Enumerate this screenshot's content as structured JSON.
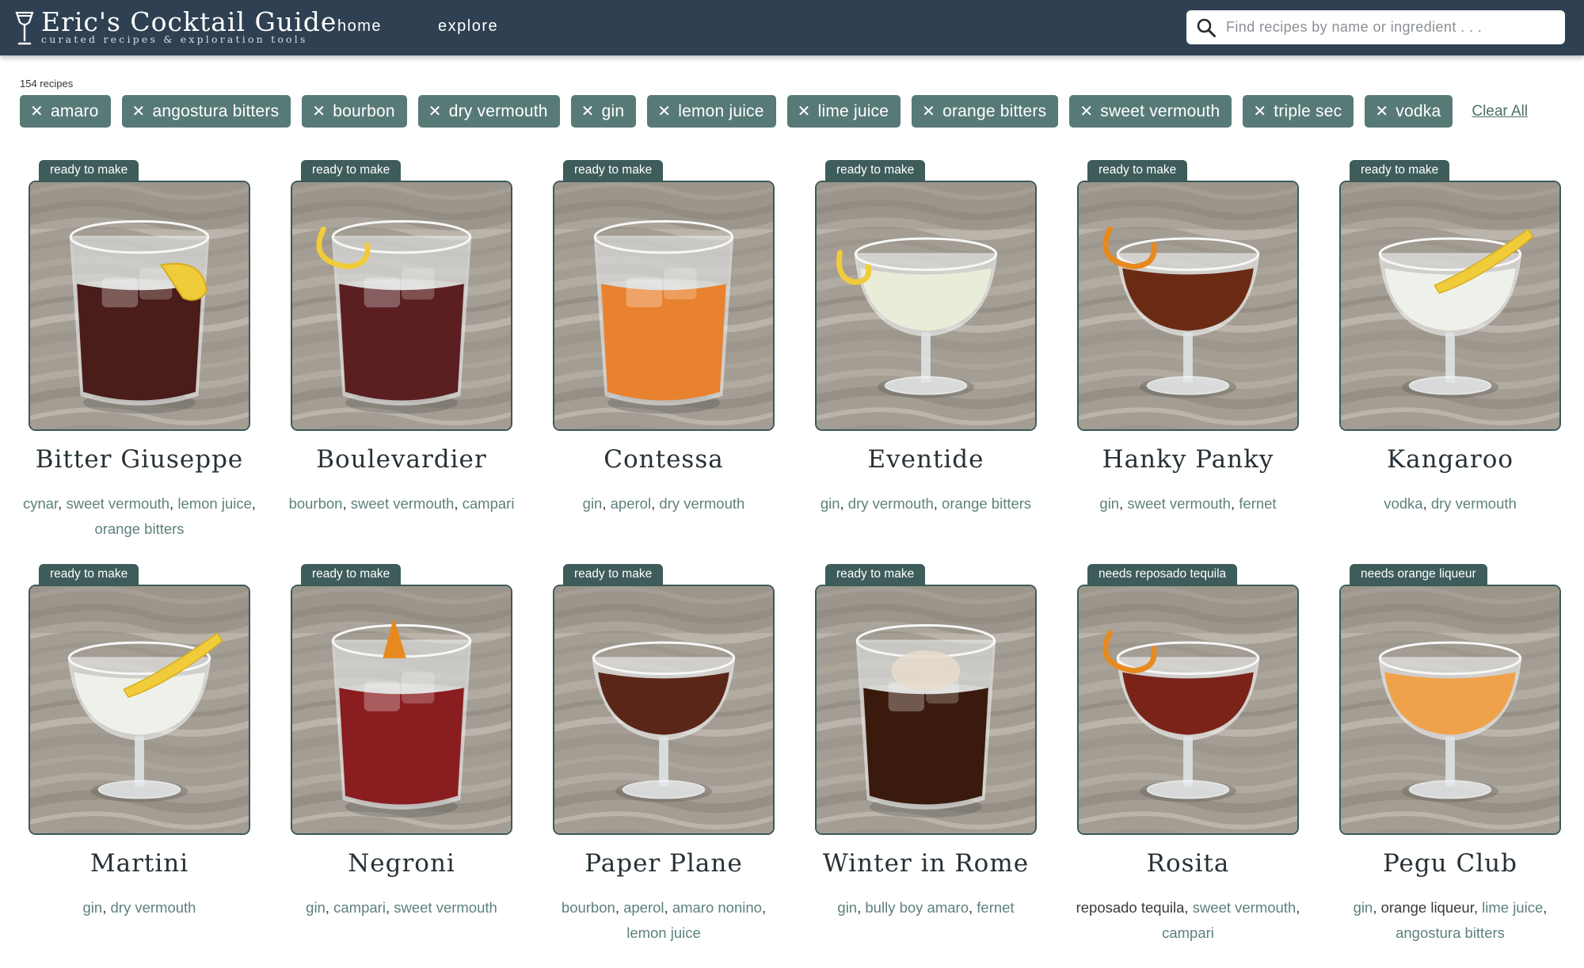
{
  "header": {
    "brand_title": "Eric's Cocktail Guide",
    "brand_subtitle": "curated recipes & exploration tools",
    "nav": [
      "home",
      "explore"
    ],
    "search_placeholder": "Find recipes by name or ingredient . . ."
  },
  "filters": {
    "recipe_count": "154 recipes",
    "chips": [
      "amaro",
      "angostura bitters",
      "bourbon",
      "dry vermouth",
      "gin",
      "lemon juice",
      "lime juice",
      "orange bitters",
      "sweet vermouth",
      "triple sec",
      "vodka"
    ],
    "clear_all": "Clear All"
  },
  "recipes": [
    {
      "name": "Bitter Giuseppe",
      "badge": "ready to make",
      "glass": "rocks",
      "liquid": "#4a1c1a",
      "garnish": "lemon-wedge",
      "ingredients": [
        {
          "t": "cynar"
        },
        {
          "t": "sweet vermouth"
        },
        {
          "t": "lemon juice"
        },
        {
          "t": "orange bitters"
        }
      ]
    },
    {
      "name": "Boulevardier",
      "badge": "ready to make",
      "glass": "rocks",
      "liquid": "#5b1f22",
      "garnish": "orange-twist",
      "ingredients": [
        {
          "t": "bourbon"
        },
        {
          "t": "sweet vermouth"
        },
        {
          "t": "campari"
        }
      ]
    },
    {
      "name": "Contessa",
      "badge": "ready to make",
      "glass": "rocks",
      "liquid": "#e8822f",
      "garnish": "none",
      "ingredients": [
        {
          "t": "gin"
        },
        {
          "t": "aperol"
        },
        {
          "t": "dry vermouth"
        }
      ]
    },
    {
      "name": "Eventide",
      "badge": "ready to make",
      "glass": "coupe",
      "liquid": "#e9ecd8",
      "garnish": "lemon-twist",
      "ingredients": [
        {
          "t": "gin"
        },
        {
          "t": "dry vermouth"
        },
        {
          "t": "orange bitters"
        }
      ]
    },
    {
      "name": "Hanky Panky",
      "badge": "ready to make",
      "glass": "coupe",
      "liquid": "#6b2a14",
      "garnish": "orange-twist",
      "ingredients": [
        {
          "t": "gin"
        },
        {
          "t": "sweet vermouth"
        },
        {
          "t": "fernet"
        }
      ]
    },
    {
      "name": "Kangaroo",
      "badge": "ready to make",
      "glass": "coupe",
      "liquid": "#eef0ea",
      "garnish": "lemon-peel",
      "ingredients": [
        {
          "t": "vodka"
        },
        {
          "t": "dry vermouth"
        }
      ]
    },
    {
      "name": "Martini",
      "badge": "ready to make",
      "glass": "coupe",
      "liquid": "#eef0ea",
      "garnish": "lemon-peel",
      "ingredients": [
        {
          "t": "gin"
        },
        {
          "t": "dry vermouth"
        }
      ]
    },
    {
      "name": "Negroni",
      "badge": "ready to make",
      "glass": "rocks",
      "liquid": "#8a1d1f",
      "garnish": "orange-peel",
      "ingredients": [
        {
          "t": "gin"
        },
        {
          "t": "campari"
        },
        {
          "t": "sweet vermouth"
        }
      ]
    },
    {
      "name": "Paper Plane",
      "badge": "ready to make",
      "glass": "coupe",
      "liquid": "#5a2618",
      "garnish": "none",
      "ingredients": [
        {
          "t": "bourbon"
        },
        {
          "t": "aperol"
        },
        {
          "t": "amaro nonino"
        },
        {
          "t": "lemon juice"
        }
      ]
    },
    {
      "name": "Winter in Rome",
      "badge": "ready to make",
      "glass": "rocks",
      "liquid": "#3a1a0c",
      "garnish": "ice",
      "ingredients": [
        {
          "t": "gin"
        },
        {
          "t": "bully boy amaro"
        },
        {
          "t": "fernet"
        }
      ]
    },
    {
      "name": "Rosita",
      "badge": "needs reposado tequila",
      "glass": "coupe",
      "liquid": "#7a2318",
      "garnish": "orange-twist",
      "ingredients": [
        {
          "t": "reposado tequila",
          "missing": true
        },
        {
          "t": "sweet vermouth"
        },
        {
          "t": "campari"
        }
      ]
    },
    {
      "name": "Pegu Club",
      "badge": "needs orange liqueur",
      "glass": "coupe",
      "liquid": "#f0a24a",
      "garnish": "none",
      "ingredients": [
        {
          "t": "gin"
        },
        {
          "t": "orange liqueur",
          "missing": true
        },
        {
          "t": "lime juice"
        },
        {
          "t": "angostura bitters"
        }
      ]
    }
  ],
  "colors": {
    "header_bg": "#2f4052",
    "accent": "#577a77",
    "badge": "#3d5c5a",
    "ingredient_link": "#5d817d"
  }
}
